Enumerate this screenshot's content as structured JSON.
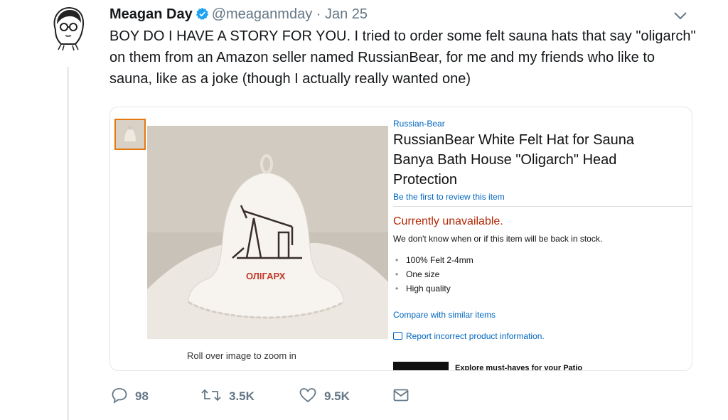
{
  "tweet": {
    "display_name": "Meagan Day",
    "handle": "@meaganmday",
    "separator": "·",
    "date": "Jan 25",
    "text": "BOY DO I HAVE A STORY FOR YOU. I tried to order some felt sauna hats that say \"oligarch\" on them from an Amazon seller named RussianBear, for me and my friends who like to sauna, like as a joke (though I actually really wanted one)",
    "verified_color": "#1da1f2"
  },
  "product": {
    "brand": "Russian-Bear",
    "title": "RussianBear White Felt Hat for Sauna Banya Bath House \"Oligarch\" Head Protection",
    "review_link": "Be the first to review this item",
    "availability": "Currently unavailable.",
    "stock_note": "We don't know when or if this item will be back in stock.",
    "features": [
      "100% Felt 2-4mm",
      "One size",
      "High quality"
    ],
    "compare_link": "Compare with similar items",
    "report_link": "Report incorrect product information.",
    "zoom_hint": "Roll over image to zoom in",
    "hat_label": "ОЛІГАРХ",
    "patio_text": "Explore must-haves for your Patio"
  },
  "actions": {
    "reply_count": "98",
    "retweet_count": "3.5K",
    "like_count": "9.5K"
  },
  "icons": [
    "avatar",
    "verified-badge-icon",
    "chevron-down-icon",
    "reply-icon",
    "retweet-icon",
    "like-icon",
    "dm-icon",
    "report-icon"
  ]
}
